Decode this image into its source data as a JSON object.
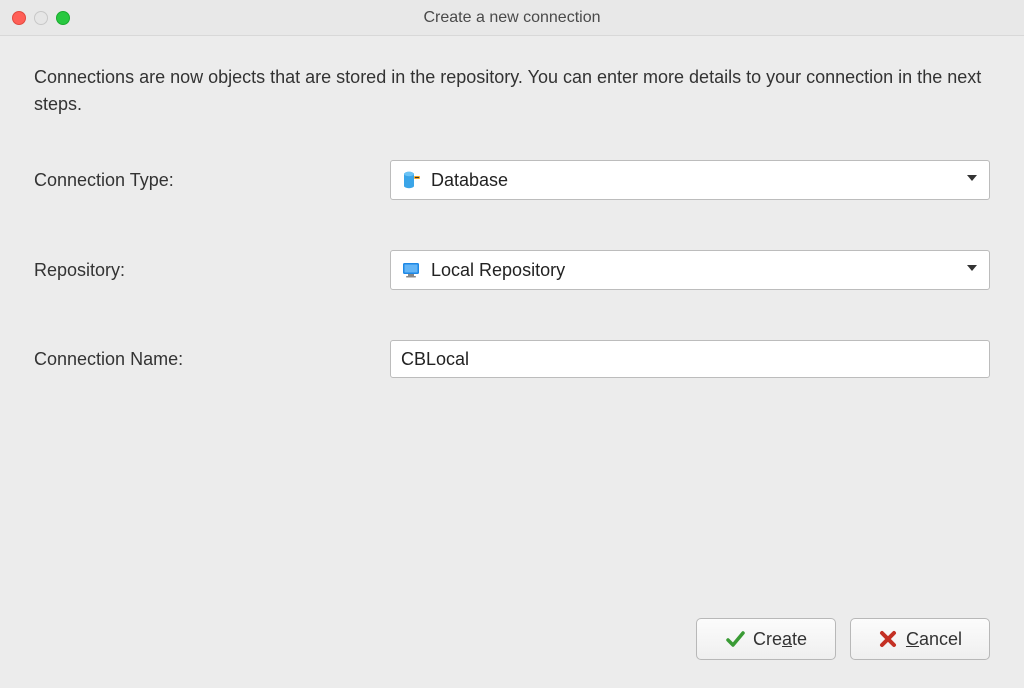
{
  "window": {
    "title": "Create a new connection"
  },
  "description": "Connections are now objects that are stored in the repository. You can enter more details to your connection in the next steps.",
  "form": {
    "connection_type": {
      "label": "Connection Type:",
      "value": "Database"
    },
    "repository": {
      "label": "Repository:",
      "value": "Local Repository"
    },
    "connection_name": {
      "label": "Connection Name:",
      "value": "CBLocal"
    }
  },
  "buttons": {
    "create": "Create",
    "cancel": "Cancel"
  }
}
